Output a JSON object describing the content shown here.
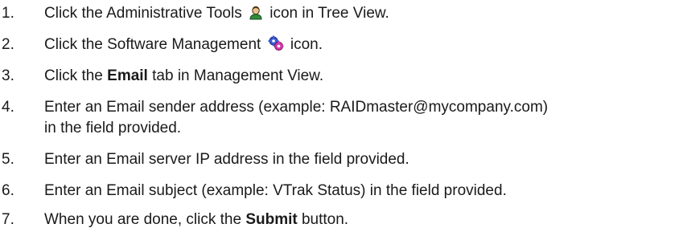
{
  "steps": [
    {
      "number": "1.",
      "before": "Click the Administrative Tools",
      "icon": "administrative-tools-person-icon",
      "after": "icon in Tree View."
    },
    {
      "number": "2.",
      "before": "Click the Software Management",
      "icon": "software-management-gears-icon",
      "after": "icon."
    },
    {
      "number": "3.",
      "before": "Click the",
      "bold": "Email",
      "after": "tab in Management View."
    },
    {
      "number": "4.",
      "line1": "Enter an Email sender address (example: RAIDmaster@mycompany.com)",
      "line2": "in the field provided."
    },
    {
      "number": "5.",
      "text": "Enter an Email server IP address in the field provided."
    },
    {
      "number": "6.",
      "text": "Enter an Email subject (example: VTrak Status) in the field provided."
    },
    {
      "number": "7.",
      "before": "When you are done, click the",
      "bold": "Submit",
      "after": "button."
    }
  ]
}
